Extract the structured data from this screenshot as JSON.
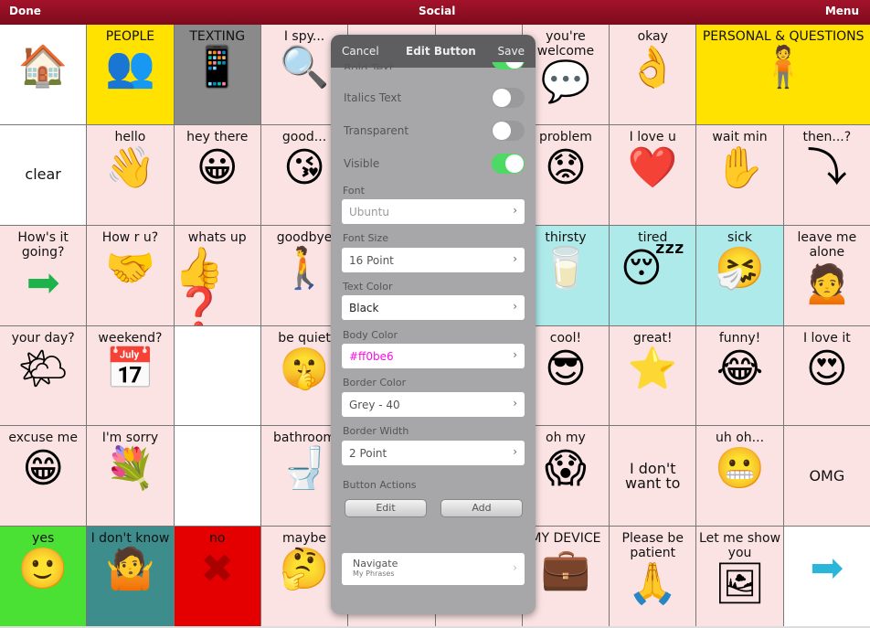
{
  "topbar": {
    "done": "Done",
    "title": "Social",
    "menu": "Menu"
  },
  "colors": {
    "topbar": "#8e0f22",
    "pink": "#fbe3e3",
    "yellow": "#ffe200",
    "grey": "#8a8a8a",
    "cyan": "#aeeaea",
    "green": "#4ae034",
    "teal": "#3d8d8d",
    "red": "#e40000",
    "white": "#ffffff"
  },
  "cells": [
    {
      "label": "",
      "icon": "home-icon",
      "glyph": "🏠",
      "bg": "white"
    },
    {
      "label": "PEOPLE",
      "icon": "people-icon",
      "glyph": "👥",
      "bg": "yellow"
    },
    {
      "label": "TEXTING",
      "icon": "phone-icon",
      "glyph": "📱",
      "bg": "grey"
    },
    {
      "label": "I spy...",
      "icon": "magnifier-icon",
      "glyph": "🔍",
      "bg": "pink"
    },
    {
      "label": "",
      "bg": "pink"
    },
    {
      "label": "",
      "bg": "pink"
    },
    {
      "label": "you're welcome",
      "icon": "people-talk-icon",
      "glyph": "💬",
      "bg": "pink"
    },
    {
      "label": "okay",
      "icon": "ok-hand-icon",
      "glyph": "👌",
      "bg": "pink"
    },
    {
      "label": "PERSONAL & QUESTIONS",
      "icon": "person-icon",
      "glyph": "🧍",
      "bg": "yellow",
      "span": 2
    },
    {
      "label": "clear",
      "bg": "white",
      "textonly": true
    },
    {
      "label": "hello",
      "icon": "wave-icon",
      "glyph": "👋",
      "bg": "pink"
    },
    {
      "label": "hey there",
      "icon": "smile-icon",
      "glyph": "😀",
      "bg": "pink"
    },
    {
      "label": "good...",
      "icon": "kiss-icon",
      "glyph": "😘",
      "bg": "pink"
    },
    {
      "label": "",
      "bg": "pink"
    },
    {
      "label": "",
      "bg": "pink"
    },
    {
      "label": "problem",
      "icon": "worried-icon",
      "glyph": "😟",
      "bg": "pink"
    },
    {
      "label": "I love u",
      "icon": "heart-icon",
      "glyph": "❤️",
      "bg": "pink"
    },
    {
      "label": "wait min",
      "icon": "hand-icon",
      "glyph": "✋",
      "bg": "pink"
    },
    {
      "label": "then...?",
      "icon": "next-icon",
      "glyph": "⤵",
      "bg": "pink"
    },
    {
      "label": "How's it going?",
      "icon": "arrow-right-icon",
      "glyph": "➡",
      "bg": "pink"
    },
    {
      "label": "How r u?",
      "icon": "handshake-icon",
      "glyph": "🤝",
      "bg": "pink"
    },
    {
      "label": "whats up",
      "icon": "question-icon",
      "glyph": "👍❓",
      "bg": "pink"
    },
    {
      "label": "goodbye",
      "icon": "goodbye-icon",
      "glyph": "🚶",
      "bg": "pink"
    },
    {
      "label": "",
      "bg": "pink"
    },
    {
      "label": "",
      "bg": "pink"
    },
    {
      "label": "thirsty",
      "icon": "drink-icon",
      "glyph": "🥛",
      "bg": "cyan"
    },
    {
      "label": "tired",
      "icon": "sleep-icon",
      "glyph": "😴",
      "bg": "cyan"
    },
    {
      "label": "sick",
      "icon": "sick-icon",
      "glyph": "🤧",
      "bg": "cyan"
    },
    {
      "label": "leave me alone",
      "icon": "alone-icon",
      "glyph": "🙍",
      "bg": "pink"
    },
    {
      "label": "your day?",
      "icon": "sun-icon",
      "glyph": "🌤",
      "bg": "pink"
    },
    {
      "label": "weekend?",
      "icon": "calendar-icon",
      "glyph": "📅",
      "bg": "pink"
    },
    {
      "label": "",
      "bg": "white"
    },
    {
      "label": "be quiet",
      "icon": "shush-icon",
      "glyph": "🤫",
      "bg": "pink"
    },
    {
      "label": "",
      "bg": "pink"
    },
    {
      "label": "",
      "bg": "pink"
    },
    {
      "label": "cool!",
      "icon": "cool-icon",
      "glyph": "😎",
      "bg": "pink"
    },
    {
      "label": "great!",
      "icon": "star-icon",
      "glyph": "⭐",
      "bg": "pink"
    },
    {
      "label": "funny!",
      "icon": "laugh-icon",
      "glyph": "😂",
      "bg": "pink"
    },
    {
      "label": "I love it",
      "icon": "love-icon",
      "glyph": "😍",
      "bg": "pink"
    },
    {
      "label": "excuse me",
      "icon": "excuse-icon",
      "glyph": "😁",
      "bg": "pink"
    },
    {
      "label": "I'm sorry",
      "icon": "sorry-icon",
      "glyph": "💐",
      "bg": "pink"
    },
    {
      "label": "",
      "bg": "white"
    },
    {
      "label": "bathroom",
      "icon": "toilet-icon",
      "glyph": "🚽",
      "bg": "pink"
    },
    {
      "label": "",
      "bg": "pink"
    },
    {
      "label": "",
      "bg": "pink"
    },
    {
      "label": "oh my",
      "icon": "shocked-icon",
      "glyph": "😱",
      "bg": "pink"
    },
    {
      "label": "I don't want to",
      "bg": "pink",
      "textonly": true
    },
    {
      "label": "uh oh...",
      "icon": "uh-oh-icon",
      "glyph": "😬",
      "bg": "pink"
    },
    {
      "label": "OMG",
      "bg": "pink",
      "textonly": true
    },
    {
      "label": "yes",
      "icon": "yes-icon",
      "glyph": "🙂",
      "bg": "green"
    },
    {
      "label": "I don't know",
      "icon": "shrug-icon",
      "glyph": "🤷",
      "bg": "teal"
    },
    {
      "label": "no",
      "icon": "x-icon",
      "glyph": "✖",
      "bg": "red"
    },
    {
      "label": "maybe",
      "icon": "maybe-icon",
      "glyph": "🤔",
      "bg": "pink"
    },
    {
      "label": "",
      "bg": "pink"
    },
    {
      "label": "",
      "bg": "pink"
    },
    {
      "label": "MY DEVICE",
      "icon": "device-icon",
      "glyph": "💼",
      "bg": "pink"
    },
    {
      "label": "Please be patient",
      "icon": "patient-icon",
      "glyph": "🙏",
      "bg": "pink"
    },
    {
      "label": "Let me show you",
      "icon": "show-icon",
      "glyph": "🖼",
      "bg": "pink"
    },
    {
      "label": "",
      "icon": "arrow-right-icon",
      "glyph": "➡",
      "bg": "white"
    }
  ],
  "popup": {
    "cancel": "Cancel",
    "title": "Edit Button",
    "save": "Save",
    "bold_text": "Bold Text",
    "bold_on": true,
    "italics": "Italics Text",
    "italics_on": false,
    "transparent": "Transparent",
    "transparent_on": false,
    "visible": "Visible",
    "visible_on": true,
    "font_label": "Font",
    "font_value": "Ubuntu",
    "size_label": "Font Size",
    "size_value": "16 Point",
    "text_color_label": "Text Color",
    "text_color_value": "Black",
    "body_color_label": "Body Color",
    "body_color_value": "#ff0be6",
    "border_color_label": "Border Color",
    "border_color_value": "Grey - 40",
    "border_width_label": "Border Width",
    "border_width_value": "2 Point",
    "actions_label": "Button Actions",
    "edit": "Edit",
    "add": "Add",
    "navigate": "Navigate",
    "navigate_sub": "My Phrases"
  }
}
